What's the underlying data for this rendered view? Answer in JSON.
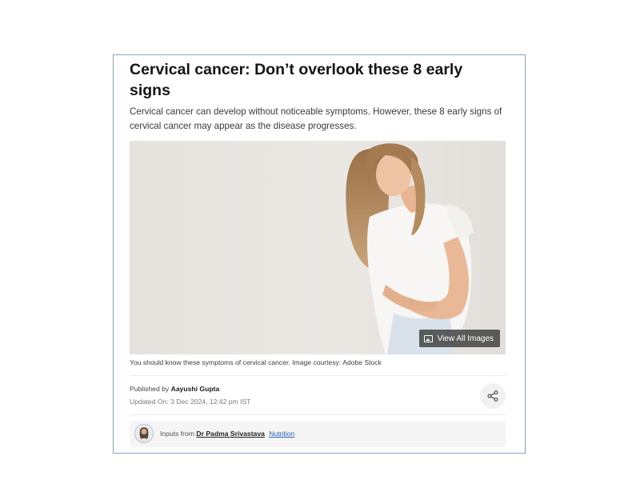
{
  "article": {
    "title": "Cervical cancer: Don’t overlook these 8 early signs",
    "description": "Cervical cancer can develop without noticeable symptoms. However, these 8 early signs of cervical cancer may appear as the disease progresses.",
    "image": {
      "view_all_label": "View All Images",
      "caption": "You should know these symptoms of cervical cancer. Image courtesy: Adobe Stock"
    },
    "published_prefix": "Published by",
    "author": "Aayushi Gupta",
    "updated": "Updated On: 3 Dec 2024, 12:42 pm IST",
    "inputs_prefix": "Inputs from",
    "expert_name": "Dr Padma Srivastava",
    "expert_field": "Nutrition"
  },
  "icons": {
    "share": "share-icon",
    "gallery": "image-icon"
  },
  "colors": {
    "link": "#1f5fbf",
    "frame_border": "#8aa2c8"
  }
}
